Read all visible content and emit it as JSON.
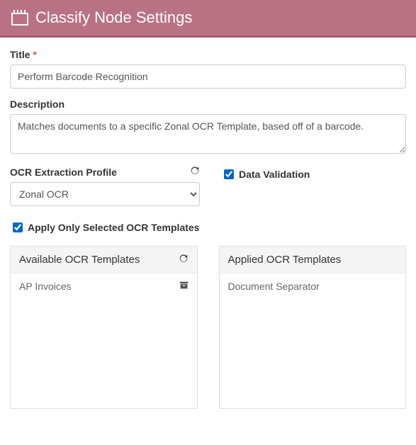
{
  "header": {
    "title": "Classify Node Settings"
  },
  "fields": {
    "title_label": "Title",
    "title_value": "Perform Barcode Recognition",
    "description_label": "Description",
    "description_value": "Matches documents to a specific Zonal OCR Template, based off of a barcode.",
    "profile_label": "OCR Extraction Profile",
    "profile_value": "Zonal OCR",
    "data_validation_label": "Data Validation",
    "apply_only_label": "Apply Only Selected OCR Templates"
  },
  "panels": {
    "available": {
      "title": "Available OCR Templates",
      "items": [
        "AP Invoices"
      ]
    },
    "applied": {
      "title": "Applied OCR Templates",
      "items": [
        "Document Separator"
      ]
    }
  }
}
